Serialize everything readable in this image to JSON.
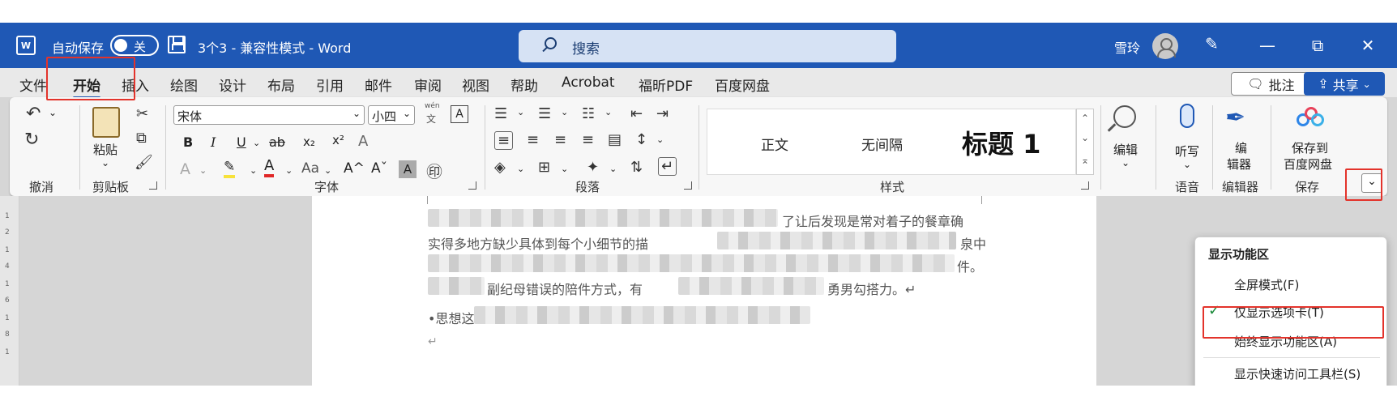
{
  "titlebar": {
    "app_icon": "word-logo-icon",
    "autosave_label": "自动保存",
    "autosave_state": "关",
    "doc_title": "3个3  -  兼容性模式  -  Word",
    "search_placeholder": "搜索",
    "user_name": "雪玲",
    "minimize": "—",
    "restore": "⧉",
    "close": "✕"
  },
  "tabs": [
    "文件",
    "开始",
    "插入",
    "绘图",
    "设计",
    "布局",
    "引用",
    "邮件",
    "审阅",
    "视图",
    "帮助",
    "Acrobat",
    "福昕PDF",
    "百度网盘"
  ],
  "active_tab": "开始",
  "comment_label": "批注",
  "share_label": "共享",
  "ribbon": {
    "undo_group": "撤消",
    "clipboard_group": "剪贴板",
    "paste_label": "粘贴",
    "font_group": "字体",
    "font_name": "宋体",
    "font_size": "小四",
    "wen_label": "wén",
    "wen_char": "文",
    "a_box": "A",
    "bold": "B",
    "italic": "I",
    "underline": "U",
    "strike": "ab",
    "subscript": "x₂",
    "superscript": "x²",
    "clear_format": "A",
    "text_effect": "A",
    "highlight": "✎",
    "font_color": "A",
    "change_case": "Aa",
    "grow_font": "A^",
    "shrink_font": "Aˇ",
    "char_shade": "A",
    "enclose": "㊞",
    "paragraph_group": "段落",
    "styles_group": "样式",
    "style_normal": "正文",
    "style_nospacing": "无间隔",
    "style_heading1": "标题 1",
    "editing_label": "编辑",
    "dictate_label": "听写",
    "voice_group": "语音",
    "editor_label_line1": "编",
    "editor_label_line2": "辑器",
    "editor_group": "编辑器",
    "save_baidu_line1": "保存到",
    "save_baidu_line2": "百度网盘",
    "save_group": "保存",
    "collapse_chevron": "⌄"
  },
  "document": {
    "line1_tail": "了让后发现是常对着子的餐章确",
    "line2_head": "实得多地方缺少具体到每个小细节的描",
    "line2_tail": "泉中",
    "line3_tail": "件。",
    "line4_head": "副纪母错误的陪件方式，有",
    "line4_tail": "勇男勾搭力。↵",
    "line5_head": "•思想这",
    "para_mark": "↵"
  },
  "ruler_marks": [
    "1",
    "2",
    "1",
    "4",
    "1",
    "6",
    "1",
    "8",
    "1"
  ],
  "menu": {
    "header": "显示功能区",
    "items": [
      {
        "label": "全屏模式(F)",
        "checked": false
      },
      {
        "label": "仅显示选项卡(T)",
        "checked": true
      },
      {
        "label": "始终显示功能区(A)",
        "checked": false
      },
      {
        "label": "显示快速访问工具栏(S)",
        "checked": false
      }
    ],
    "check_mark": "✓"
  },
  "colors": {
    "titlebar": "#1f58b5",
    "accent": "#1f58b5",
    "highlight_box": "#e3332b"
  }
}
